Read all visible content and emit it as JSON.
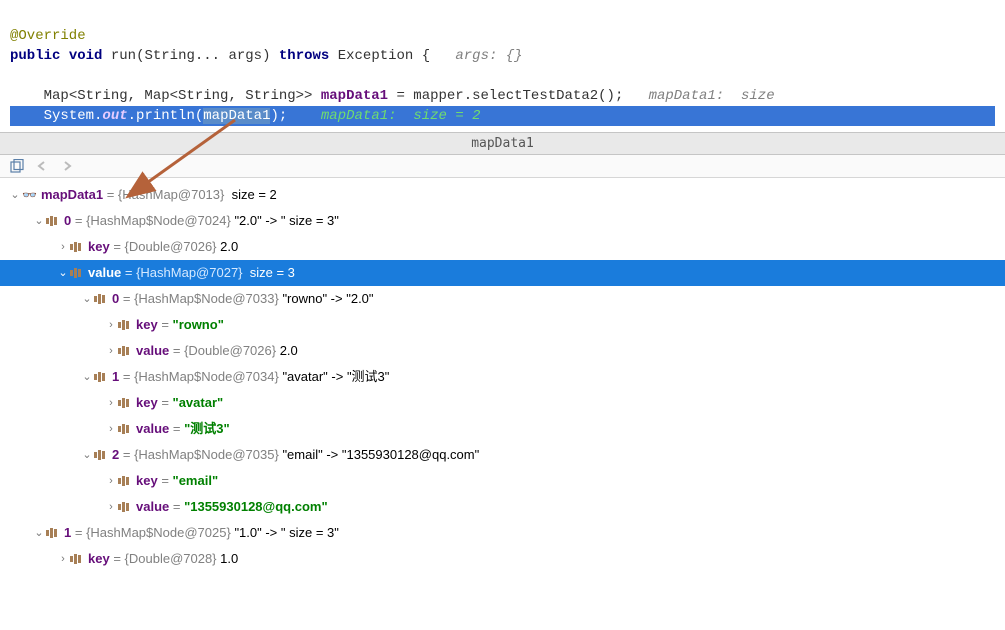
{
  "code": {
    "annotation": "@Override",
    "kw_public": "public",
    "kw_void": "void",
    "method": "run",
    "params": "(String... args)",
    "kw_throws": "throws",
    "exception": "Exception {",
    "comment_args": "args: {}",
    "map_decl": "Map<String, Map<String, String>>",
    "var1": "mapData1",
    "eq": " = ",
    "mapper": "mapper",
    "method_call": ".selectTestData2();",
    "comment_inline1": "mapData1:  size",
    "sys": "System.",
    "out": "out",
    "println": ".println(",
    "hl_var": "mapData1",
    "close": ");",
    "comment_inline2": "mapData1:  size = 2"
  },
  "panel": {
    "title": "mapData1"
  },
  "tree": {
    "root": {
      "name": "mapData1",
      "type": "{HashMap@7013}",
      "size": "size = 2"
    },
    "n0": {
      "idx": "0",
      "type": "{HashMap$Node@7024}",
      "val": "\"2.0\" -> \" size = 3\""
    },
    "n0_key": {
      "label": "key",
      "type": "{Double@7026}",
      "val": "2.0"
    },
    "n0_val": {
      "label": "value",
      "type": "{HashMap@7027}",
      "size": "size = 3"
    },
    "n0_v0": {
      "idx": "0",
      "type": "{HashMap$Node@7033}",
      "val": "\"rowno\" -> \"2.0\""
    },
    "n0_v0_key": {
      "label": "key",
      "val": "\"rowno\""
    },
    "n0_v0_val": {
      "label": "value",
      "type": "{Double@7026}",
      "val": "2.0"
    },
    "n0_v1": {
      "idx": "1",
      "type": "{HashMap$Node@7034}",
      "val": "\"avatar\" -> \"测试3\""
    },
    "n0_v1_key": {
      "label": "key",
      "val": "\"avatar\""
    },
    "n0_v1_val": {
      "label": "value",
      "val": "\"测试3\""
    },
    "n0_v2": {
      "idx": "2",
      "type": "{HashMap$Node@7035}",
      "val": "\"email\" -> \"1355930128@qq.com\""
    },
    "n0_v2_key": {
      "label": "key",
      "val": "\"email\""
    },
    "n0_v2_val": {
      "label": "value",
      "val": "\"1355930128@qq.com\""
    },
    "n1": {
      "idx": "1",
      "type": "{HashMap$Node@7025}",
      "val": "\"1.0\" -> \" size = 3\""
    },
    "n1_key": {
      "label": "key",
      "type": "{Double@7028}",
      "val": "1.0"
    }
  }
}
